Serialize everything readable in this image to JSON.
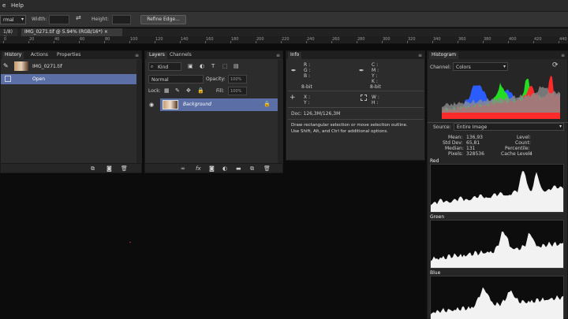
{
  "menubar": {
    "items": [
      "e",
      "Help"
    ]
  },
  "options": {
    "style_value": "rmal",
    "width_label": "Width:",
    "height_label": "Height:",
    "swap_icon": "swap-arrows-icon",
    "refine_label": "Refine Edge..."
  },
  "tabs": [
    {
      "label": "1/8) ×"
    },
    {
      "label": "IMG_0271.tif @ 5.94% (RGB/16*) ×"
    }
  ],
  "ruler": [
    "0",
    "20",
    "40",
    "60",
    "80",
    "100",
    "120",
    "140",
    "160",
    "180",
    "200",
    "220",
    "240",
    "260",
    "280",
    "300",
    "320",
    "340",
    "360",
    "380",
    "400",
    "420",
    "440"
  ],
  "history": {
    "tabs": [
      "History",
      "Actions",
      "Properties"
    ],
    "snapshot": "IMG_0271.tif",
    "step": "Open"
  },
  "layers": {
    "tabs": [
      "Layers",
      "Channels"
    ],
    "kind": "Kind",
    "blend": "Normal",
    "opacity_label": "Opacity:",
    "opacity_value": "100%",
    "lock_label": "Lock:",
    "fill_label": "Fill:",
    "fill_value": "100%",
    "layer_name": "Background"
  },
  "info": {
    "tab": "Info",
    "r": "R :",
    "g": "G :",
    "b": "B :",
    "c": "C :",
    "m": "M :",
    "y": "Y :",
    "k": "K :",
    "bit_left": "8-bit",
    "bit_right": "8-bit",
    "x": "X :",
    "yy": "Y :",
    "w": "W :",
    "h": "H :",
    "doc": "Doc: 126,3M/126,3M",
    "hint1": "Draw rectangular selection or move selection outline.",
    "hint2": "Use Shift, Alt, and Ctrl for additional options."
  },
  "histogram": {
    "tab": "Histogram",
    "channel_label": "Channel:",
    "channel_value": "Colors",
    "source_label": "Source:",
    "source_value": "Entire Image",
    "stats": {
      "mean_label": "Mean:",
      "mean": "136,93",
      "std_label": "Std Dev:",
      "std": "65,81",
      "median_label": "Median:",
      "median": "131",
      "pixels_label": "Pixels:",
      "pixels": "328536",
      "level_label": "Level:",
      "count_label": "Count:",
      "percentile_label": "Percentile:",
      "cache_label": "Cache Level:",
      "cache": "4"
    },
    "red_label": "Red",
    "green_label": "Green",
    "blue_label": "Blue",
    "colors": {
      "red": "#ff2a2a",
      "green": "#22dd22",
      "blue": "#2a5cff",
      "cyan": "#24d6e0",
      "magenta": "#d62ad6",
      "yellow": "#f4e22a"
    }
  }
}
